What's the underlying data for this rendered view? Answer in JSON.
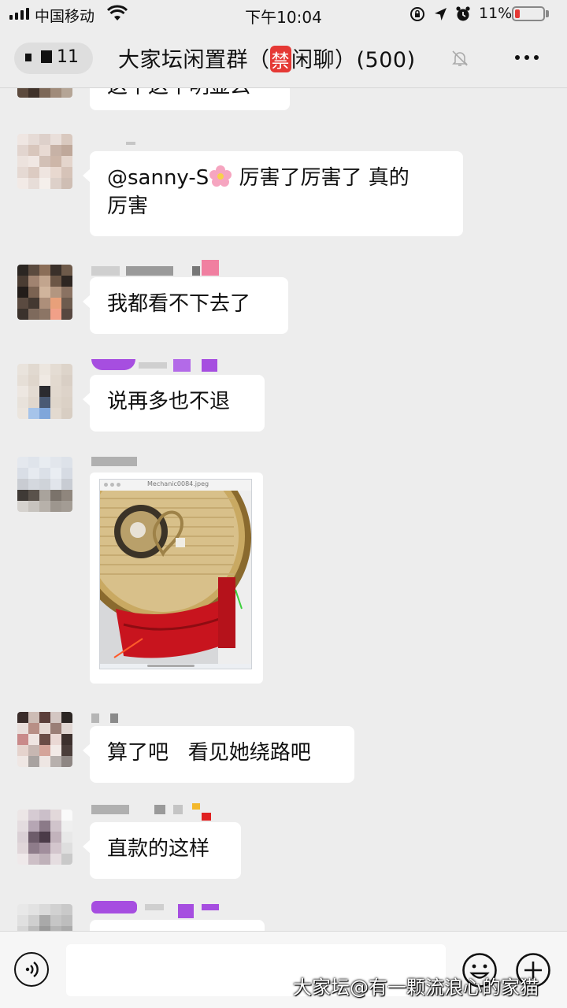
{
  "status_bar": {
    "carrier": "中国移动",
    "time": "下午10:04",
    "battery_percent": "11%",
    "battery_level": 0.11
  },
  "nav": {
    "back_badge": "11",
    "title_prefix": "大家坛闲置群（",
    "title_badge": "禁",
    "title_suffix": "闲聊）(500)"
  },
  "messages": [
    {
      "type": "text",
      "text": "这个这个明显么"
    },
    {
      "type": "text",
      "text": "@sanny-S",
      "text_after_emoji": " 厉害了厉害了 真的",
      "line2": "厉害",
      "emoji": "flower-icon"
    },
    {
      "type": "text",
      "text": "我都看不下去了"
    },
    {
      "type": "text",
      "text": "说再多也不退"
    },
    {
      "type": "image",
      "filename": "Mechanic0084.jpeg"
    },
    {
      "type": "text",
      "text": "算了吧   看见她绕路吧"
    },
    {
      "type": "text",
      "text": "直款的这样"
    },
    {
      "type": "text",
      "text": ""
    }
  ],
  "input_bar": {
    "placeholder": ""
  },
  "watermark": "大家坛@有一颗流浪心的家猫",
  "colors": {
    "background": "#ededed",
    "bubble": "#ffffff",
    "badge_red": "#e53935",
    "name_purple": "#a64ee0"
  },
  "icons": [
    "signal-icon",
    "wifi-icon",
    "lock-rotation-icon",
    "location-icon",
    "alarm-icon",
    "battery-icon",
    "mute-icon",
    "more-icon",
    "voice-icon",
    "emoji-icon",
    "plus-icon"
  ]
}
